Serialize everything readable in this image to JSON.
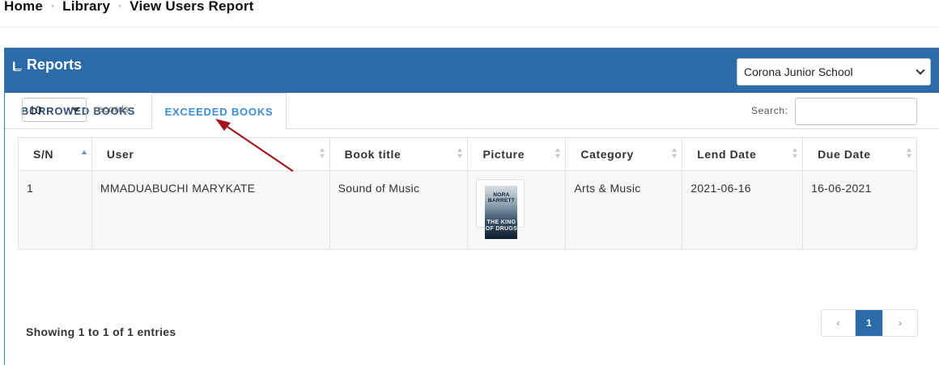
{
  "breadcrumb": {
    "home": "Home",
    "library": "Library",
    "current": "View Users Report"
  },
  "panel": {
    "title": "Reports",
    "school_select": "Corona Junior School"
  },
  "tabs": [
    {
      "label": "BORROWED BOOKS",
      "active": false
    },
    {
      "label": "EXCEEDED BOOKS",
      "active": true
    }
  ],
  "controls": {
    "length_value": "10",
    "records_label": "records",
    "search_label": "Search:"
  },
  "table": {
    "headers": [
      "S/N",
      "User",
      "Book title",
      "Picture",
      "Category",
      "Lend Date",
      "Due Date"
    ],
    "rows": [
      {
        "sn": "1",
        "user": "MMADUABUCHI MARYKATE",
        "title": "Sound of Music",
        "category": "Arts & Music",
        "lend_date": "2021-06-16",
        "due_date": "16-06-2021",
        "cover": {
          "author": "NORA BARRETT",
          "title": "THE KING OF DRUGS"
        }
      }
    ]
  },
  "footer": {
    "showing": "Showing 1 to 1 of 1 entries",
    "pager": {
      "prev": "‹",
      "page": "1",
      "next": "›"
    }
  },
  "colors": {
    "header_blue": "#2b6ca8",
    "tab_active": "#3a8dd6",
    "annotation_arrow": "#a3151a"
  }
}
